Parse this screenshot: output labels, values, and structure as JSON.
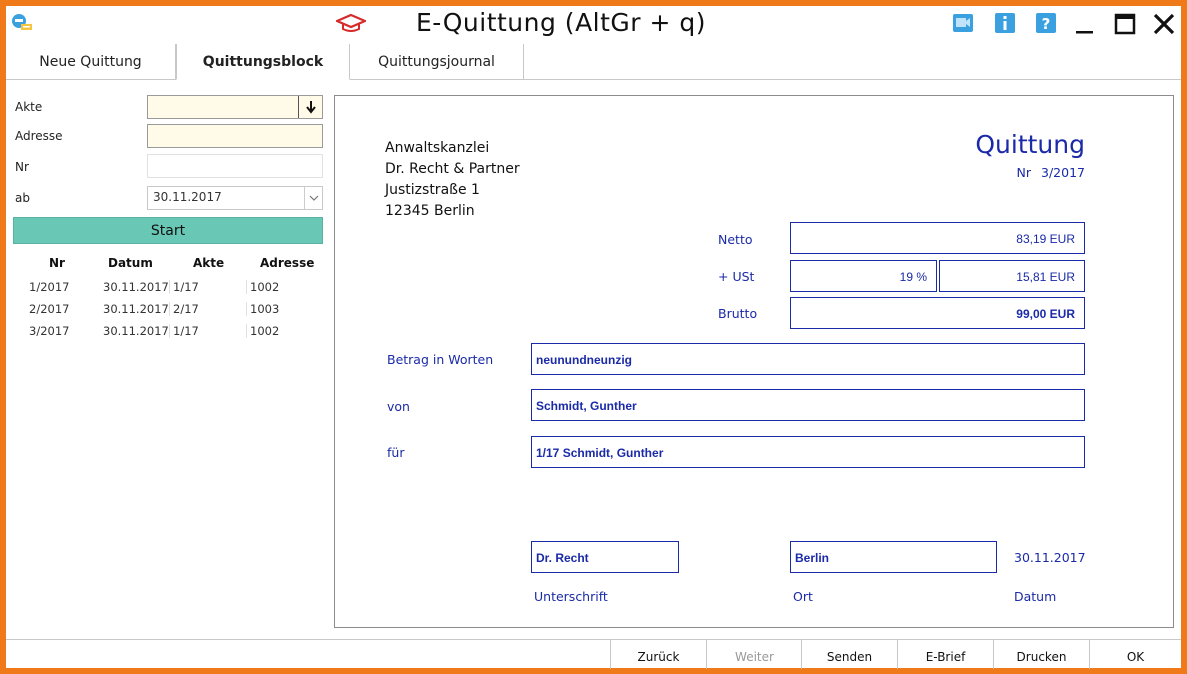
{
  "window": {
    "title": "E-Quittung (AltGr + q)"
  },
  "tabs": [
    {
      "label": "Neue Quittung",
      "active": false
    },
    {
      "label": "Quittungsblock",
      "active": true
    },
    {
      "label": "Quittungsjournal",
      "active": false
    }
  ],
  "filters": {
    "akte_label": "Akte",
    "akte_value": "",
    "adresse_label": "Adresse",
    "adresse_value": "",
    "nr_label": "Nr",
    "nr_value": "",
    "ab_label": "ab",
    "ab_value": "30.11.2017",
    "start_label": "Start"
  },
  "table": {
    "headers": [
      "Nr",
      "Datum",
      "Akte",
      "Adresse"
    ],
    "rows": [
      [
        "1/2017",
        "30.11.2017",
        "1/17",
        "1002"
      ],
      [
        "2/2017",
        "30.11.2017",
        "2/17",
        "1003"
      ],
      [
        "3/2017",
        "30.11.2017",
        "1/17",
        "1002"
      ]
    ]
  },
  "receipt": {
    "sender": {
      "line1": "Anwaltskanzlei",
      "line2": "Dr. Recht & Partner",
      "line3": "Justizstraße 1",
      "line4": "12345 Berlin"
    },
    "title": "Quittung",
    "nr_label": "Nr",
    "nr_value": "3/2017",
    "netto_label": "Netto",
    "netto_value": "83,19 EUR",
    "ust_label": "+ USt",
    "ust_rate": "19 %",
    "ust_value": "15,81 EUR",
    "brutto_label": "Brutto",
    "brutto_value": "99,00 EUR",
    "betrag_label": "Betrag in Worten",
    "betrag_value": "neunundneunzig",
    "von_label": "von",
    "von_value": "Schmidt, Gunther",
    "fuer_label": "für",
    "fuer_value": "1/17 Schmidt, Gunther",
    "unterschrift_value": "Dr. Recht",
    "unterschrift_label": "Unterschrift",
    "ort_value": "Berlin",
    "ort_label": "Ort",
    "datum_value": "30.11.2017",
    "datum_label": "Datum"
  },
  "bottom_buttons": [
    {
      "label": "Zurück",
      "enabled": true
    },
    {
      "label": "Weiter",
      "enabled": false
    },
    {
      "label": "Senden",
      "enabled": true
    },
    {
      "label": "E-Brief",
      "enabled": true
    },
    {
      "label": "Drucken",
      "enabled": true
    },
    {
      "label": "OK",
      "enabled": true
    }
  ],
  "colors": {
    "frame": "#f07a1a",
    "accent_blue": "#1a2aa8",
    "start_button": "#69c7b5",
    "input_highlight": "#fffbe8",
    "icon_blue": "#3aa0e0"
  }
}
